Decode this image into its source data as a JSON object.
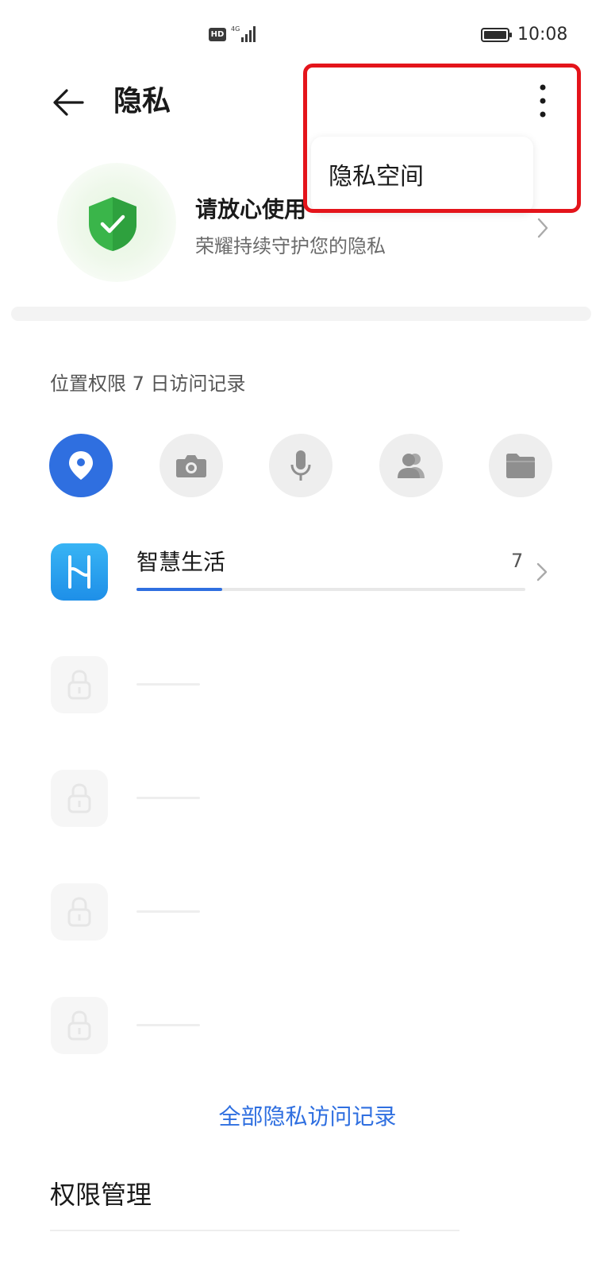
{
  "status_bar": {
    "hd_label": "HD",
    "network_label": "4G",
    "time": "10:08",
    "icons": [
      "signal-icon",
      "battery-icon"
    ]
  },
  "header": {
    "title": "隐私",
    "icons": [
      "back-arrow-icon",
      "more-vertical-icon"
    ]
  },
  "popup_menu": {
    "items": [
      {
        "label": "隐私空间"
      }
    ]
  },
  "security_card": {
    "title": "请放心使用",
    "subtitle": "荣耀持续守护您的隐私",
    "icon": "shield-check-icon",
    "colors": {
      "shield": "#3ab54a"
    }
  },
  "access_records": {
    "section_label": "位置权限 7 日访问记录",
    "permissions": [
      {
        "icon": "location-icon",
        "active": true
      },
      {
        "icon": "camera-icon",
        "active": false
      },
      {
        "icon": "microphone-icon",
        "active": false
      },
      {
        "icon": "contacts-icon",
        "active": false
      },
      {
        "icon": "folder-icon",
        "active": false
      }
    ],
    "apps": [
      {
        "name": "智慧生活",
        "count": "7",
        "icon": "smart-life-app-icon",
        "progress": 0.22
      }
    ],
    "placeholder_rows": 4,
    "all_records_link": "全部隐私访问记录"
  },
  "permission_management": {
    "label": "权限管理"
  },
  "colors": {
    "accent": "#2f6fe0",
    "highlight": "#e4141b"
  }
}
